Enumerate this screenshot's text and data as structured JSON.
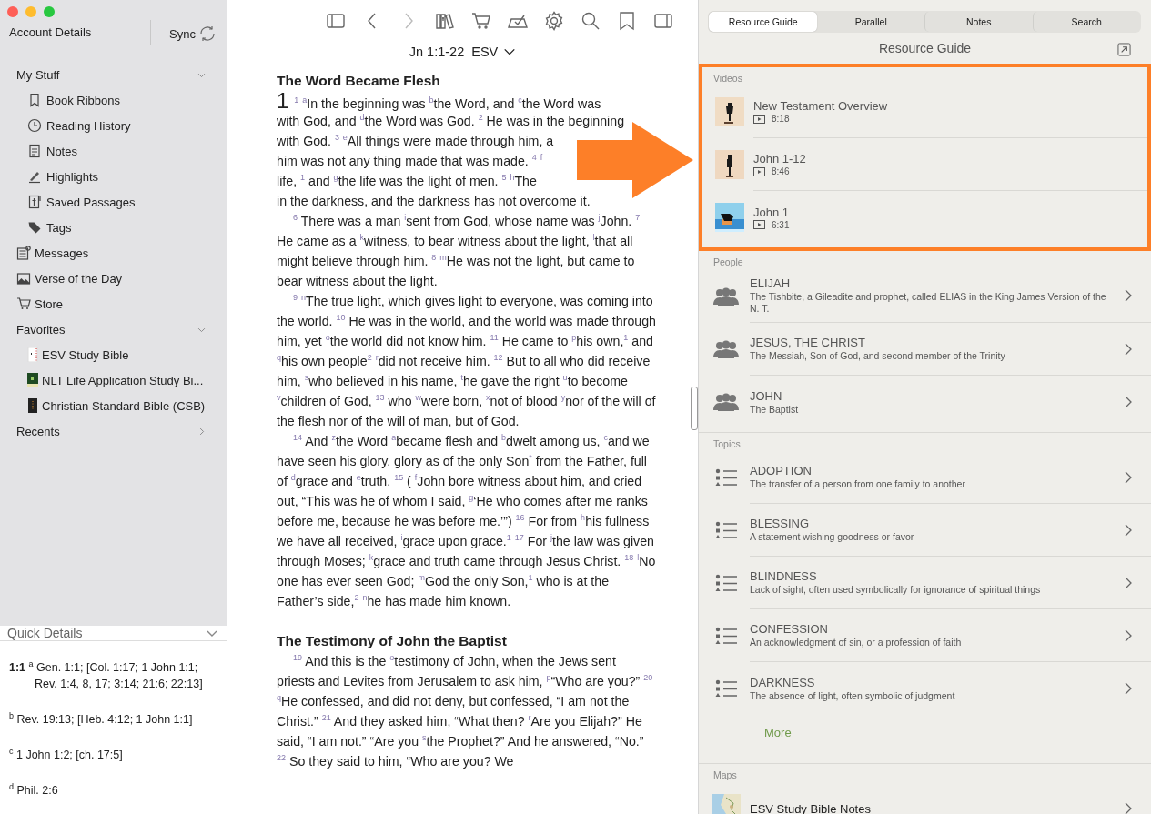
{
  "sidebar": {
    "account": "Account Details",
    "sync": "Sync",
    "items": [
      {
        "kind": "group",
        "label": "My Stuff",
        "expanded": true,
        "children": [
          {
            "label": "Book Ribbons"
          },
          {
            "label": "Reading History"
          },
          {
            "label": "Notes"
          },
          {
            "label": "Highlights"
          },
          {
            "label": "Saved Passages"
          },
          {
            "label": "Tags"
          }
        ]
      },
      {
        "kind": "link",
        "label": "Messages"
      },
      {
        "kind": "link",
        "label": "Verse of the Day"
      },
      {
        "kind": "link",
        "label": "Store"
      },
      {
        "kind": "group",
        "label": "Favorites",
        "expanded": true,
        "children": [
          {
            "label": "ESV Study Bible"
          },
          {
            "label": "NLT Life Application Study Bi..."
          },
          {
            "label": "Christian Standard Bible (CSB)"
          }
        ]
      },
      {
        "kind": "group",
        "label": "Recents",
        "expanded": false
      }
    ]
  },
  "quick_details": {
    "title": "Quick Details",
    "expanded": true,
    "notes": [
      "**1:1** $^{a}$ Gen. 1:1; [Col. 1:17; 1 John 1:1; Rev. 1:4, 8, 17; 3:14; 21:6; 22:13]",
      "$^{b}$ Rev. 19:13; [Heb. 4:12; 1 John 1:1]",
      "$^{c}$ 1 John 1:2; [ch. 17:5]",
      "$^{d}$ Phil. 2:6"
    ]
  },
  "reader": {
    "reference": "Jn 1:1-22",
    "version": "ESV",
    "sections": [
      {
        "heading": "The Word Became Flesh",
        "chapter": "1",
        "paragraphs": [
          {
            "kind": "lines",
            "lines": [
              "$^{1}$ $^{a}$In the beginning was $^{b}$the Word, and $^{c}$the Word was",
              "with God, and $^{d}$the Word was God. $^{2}$ He was in the beginning",
              "with God. $^{3}$ $^{e}$All things were made through him, a",
              "him was not any thing made that was made. $^{4}$ $^{f}$",
              "life, $^{1}$ and $^{g}$the life was the light of men. $^{5}$ $^{h}$The",
              "in the darkness, and the darkness has not overcome it."
            ]
          },
          "$^{6}$ There was a man $^{i}$sent from God, whose name was $^{j}$John. $^{7}$ He came as a $^{k}$witness, to bear witness about the light, $^{l}$that all might believe through him. $^{8}$ $^{m}$He was not the light, but came to bear witness about the light.",
          "$^{9}$ $^{n}$The true light, which gives light to everyone, was coming into the world. $^{10}$ He was in the world, and the world was made through him, yet $^{o}$the world did not know him. $^{11}$ He came to $^{p}$his own,$^{1}$ and $^{q}$his own people$^{2}$ $^{r}$did not receive him. $^{12}$ But to all who did receive him, $^{s}$who believed in his name, $^{t}$he gave the right $^{u}$to become $^{v}$children of God, $^{13}$ who $^{w}$were born, $^{x}$not of blood $^{y}$nor of the will of the flesh nor of the will of man, but of God.",
          "$^{14}$ And $^{z}$the Word $^{a}$became flesh and $^{b}$dwelt among us, $^{c}$and we have seen his glory, glory as of the only Son$^{*}$ from the Father, full of $^{d}$grace and $^{e}$truth. $^{15}$ ( $^{f}$John bore witness about him, and cried out, “This was he of whom I said, $^{g}$‘He who comes after me ranks before me, because he was before me.’”) $^{16}$ For from $^{h}$his fullness we have all received, $^{i}$grace upon grace.$^{1}$ $^{17}$ For $^{j}$the law was given through Moses; $^{k}$grace and truth came through Jesus Christ. $^{18}$ $^{l}$No one has ever seen God; $^{m}$God the only Son,$^{1}$ who is at the Father’s side,$^{2}$ $^{n}$he has made him known."
        ]
      },
      {
        "heading": "The Testimony of John the Baptist",
        "paragraphs": [
          "$^{19}$ And this is the $^{o}$testimony of John, when the Jews sent priests and Levites from Jerusalem to ask him, $^{p}$“Who are you?” $^{20}$ $^{q}$He confessed, and did not deny, but confessed, “I am not the Christ.” $^{21}$ And they asked him, “What then? $^{r}$Are you Elijah?” He said, “I am not.” “Are you $^{s}$the Prophet?” And he answered, “No.” $^{22}$ So they said to him, “Who are you? We"
        ]
      }
    ]
  },
  "guide": {
    "tabs": [
      {
        "label": "Resource Guide",
        "selected": true
      },
      {
        "label": "Parallel",
        "selected": false
      },
      {
        "label": "Notes",
        "selected": false
      },
      {
        "label": "Search",
        "selected": false
      }
    ],
    "title": "Resource Guide",
    "sections": [
      {
        "title": "Videos",
        "kind": "video",
        "highlighted": true,
        "items": [
          {
            "title": "New Testament Overview",
            "duration": "8:18"
          },
          {
            "title": "John 1-12",
            "duration": "8:46"
          },
          {
            "title": "John 1",
            "duration": "6:31"
          }
        ]
      },
      {
        "title": "People",
        "kind": "person",
        "highlighted": false,
        "items": [
          {
            "title": "ELIJAH",
            "subtitle": "The Tishbite, a Gileadite and prophet, called ELIAS in the King James Version of the N. T."
          },
          {
            "title": "JESUS, THE CHRIST",
            "subtitle": "The Messiah, Son of God, and second member of the Trinity"
          },
          {
            "title": "JOHN",
            "subtitle": "The Baptist"
          }
        ]
      },
      {
        "title": "Topics",
        "kind": "topic",
        "highlighted": false,
        "more": "More",
        "items": [
          {
            "title": "ADOPTION",
            "subtitle": "The transfer of a person from one family to another"
          },
          {
            "title": "BLESSING",
            "subtitle": "A statement wishing goodness or favor"
          },
          {
            "title": "BLINDNESS",
            "subtitle": "Lack of sight, often used symbolically for ignorance of spiritual things"
          },
          {
            "title": "CONFESSION",
            "subtitle": "An acknowledgment of sin, or a profession of faith"
          },
          {
            "title": "DARKNESS",
            "subtitle": "The absence of light, often symbolic of judgment"
          }
        ]
      },
      {
        "title": "Maps",
        "kind": "map",
        "highlighted": false,
        "items": [
          {
            "title": "ESV Study Bible Notes"
          }
        ]
      }
    ]
  }
}
